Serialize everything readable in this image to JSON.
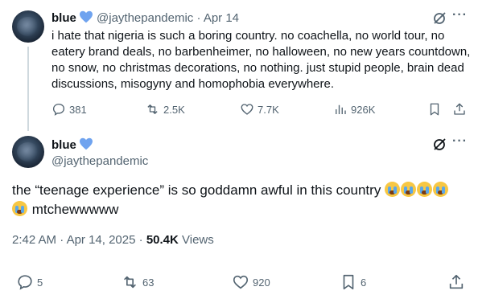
{
  "parent_tweet": {
    "display_name": "blue",
    "handle": "@jaythepandemic",
    "separator": "·",
    "date": "Apr 14",
    "text": "i hate that nigeria is such a boring country. no coachella, no world tour, no eatery brand deals, no barbenheimer, no halloween, no new years countdown, no snow, no christmas decorations, no nothing. just stupid people, brain dead discussions, misogyny and homophobia everywhere.",
    "replies": "381",
    "reposts": "2.5K",
    "likes": "7.7K",
    "views": "926K"
  },
  "main_tweet": {
    "display_name": "blue",
    "handle": "@jaythepandemic",
    "text": "the “teenage experience” is so goddamn awful in this country",
    "text_line2": "mtchewwwww",
    "time": "2:42 AM",
    "separator": "·",
    "date": "Apr 14, 2025",
    "separator2": "·",
    "views_count": "50.4K",
    "views_label": "Views",
    "replies": "5",
    "reposts": "63",
    "likes": "920",
    "bookmarks": "6"
  },
  "icons": {
    "verified": "verified-heart-icon",
    "grok": "grok-icon",
    "more": "more-icon"
  },
  "colors": {
    "verified": "#6fa3ef",
    "secondary_text": "#536471",
    "thread_line": "#cfd9de"
  }
}
